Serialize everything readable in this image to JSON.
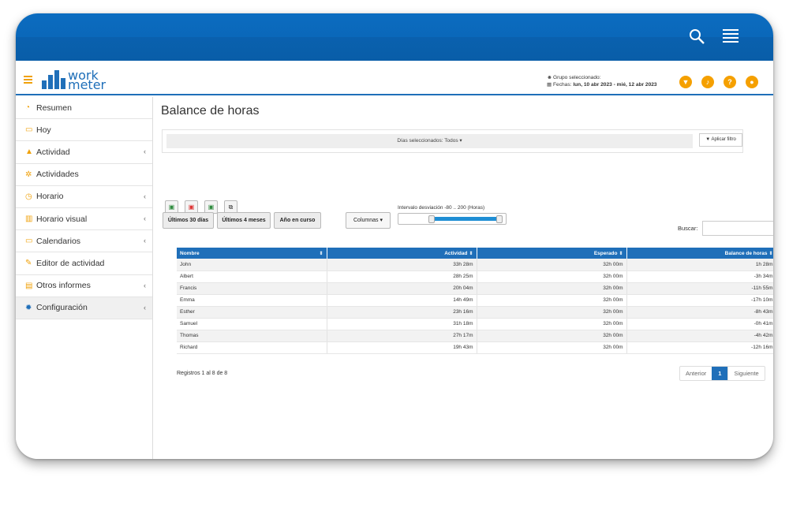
{
  "header": {
    "logo_line1": "work",
    "logo_line2": "meter",
    "group_label": "Grupo seleccionado:",
    "dates_label": "Fechas:",
    "dates_value": "lun, 10 abr 2023 - mié, 12 abr 2023",
    "accent_color": "#1f6fb9",
    "warn_color": "#f5a000"
  },
  "sidebar": {
    "items": [
      {
        "label": "Resumen",
        "icon": "dashboard-icon"
      },
      {
        "label": "Hoy",
        "icon": "calendar-icon"
      },
      {
        "label": "Actividad",
        "icon": "area-chart-icon"
      },
      {
        "label": "Actividades",
        "icon": "cogs-icon"
      },
      {
        "label": "Horario",
        "icon": "clock-icon"
      },
      {
        "label": "Horario visual",
        "icon": "bar-chart-icon"
      },
      {
        "label": "Calendarios",
        "icon": "calendar-icon"
      },
      {
        "label": "Editor de actividad",
        "icon": "edit-icon"
      },
      {
        "label": "Otros informes",
        "icon": "table-icon"
      },
      {
        "label": "Configuración",
        "icon": "gear-icon"
      }
    ]
  },
  "main": {
    "title": "Balance de horas",
    "filter_text": "Días seleccionados: Todos ▾",
    "apply_filter": "Aplicar filtro",
    "btn_30": "Últimos 30 días",
    "btn_4m": "Últimos 4 meses",
    "btn_year": "Año en curso",
    "btn_columns": "Columnas",
    "deviation_label": "Intervalo desviación -80 .. 200 (Horas)",
    "search_label": "Buscar:",
    "columns": [
      "Nombre",
      "Actividad",
      "Esperado",
      "Balance de horas"
    ],
    "rows": [
      {
        "name": "John",
        "activity": "33h 28m",
        "expected": "32h 00m",
        "balance": "1h 28m"
      },
      {
        "name": "Albert",
        "activity": "28h 25m",
        "expected": "32h 00m",
        "balance": "-3h 34m"
      },
      {
        "name": "Francis",
        "activity": "20h 04m",
        "expected": "32h 00m",
        "balance": "-11h 55m"
      },
      {
        "name": "Emma",
        "activity": "14h 49m",
        "expected": "32h 00m",
        "balance": "-17h 10m"
      },
      {
        "name": "Esther",
        "activity": "23h 16m",
        "expected": "32h 00m",
        "balance": "-8h 43m"
      },
      {
        "name": "Samuel",
        "activity": "31h 18m",
        "expected": "32h 00m",
        "balance": "-0h 41m"
      },
      {
        "name": "Thomas",
        "activity": "27h 17m",
        "expected": "32h 00m",
        "balance": "-4h 42m"
      },
      {
        "name": "Richard",
        "activity": "19h 43m",
        "expected": "32h 00m",
        "balance": "-12h 16m"
      }
    ],
    "records_info": "Registros 1 al 8 de 8",
    "pager_prev": "Anterior",
    "pager_current": "1",
    "pager_next": "Siguiente"
  }
}
